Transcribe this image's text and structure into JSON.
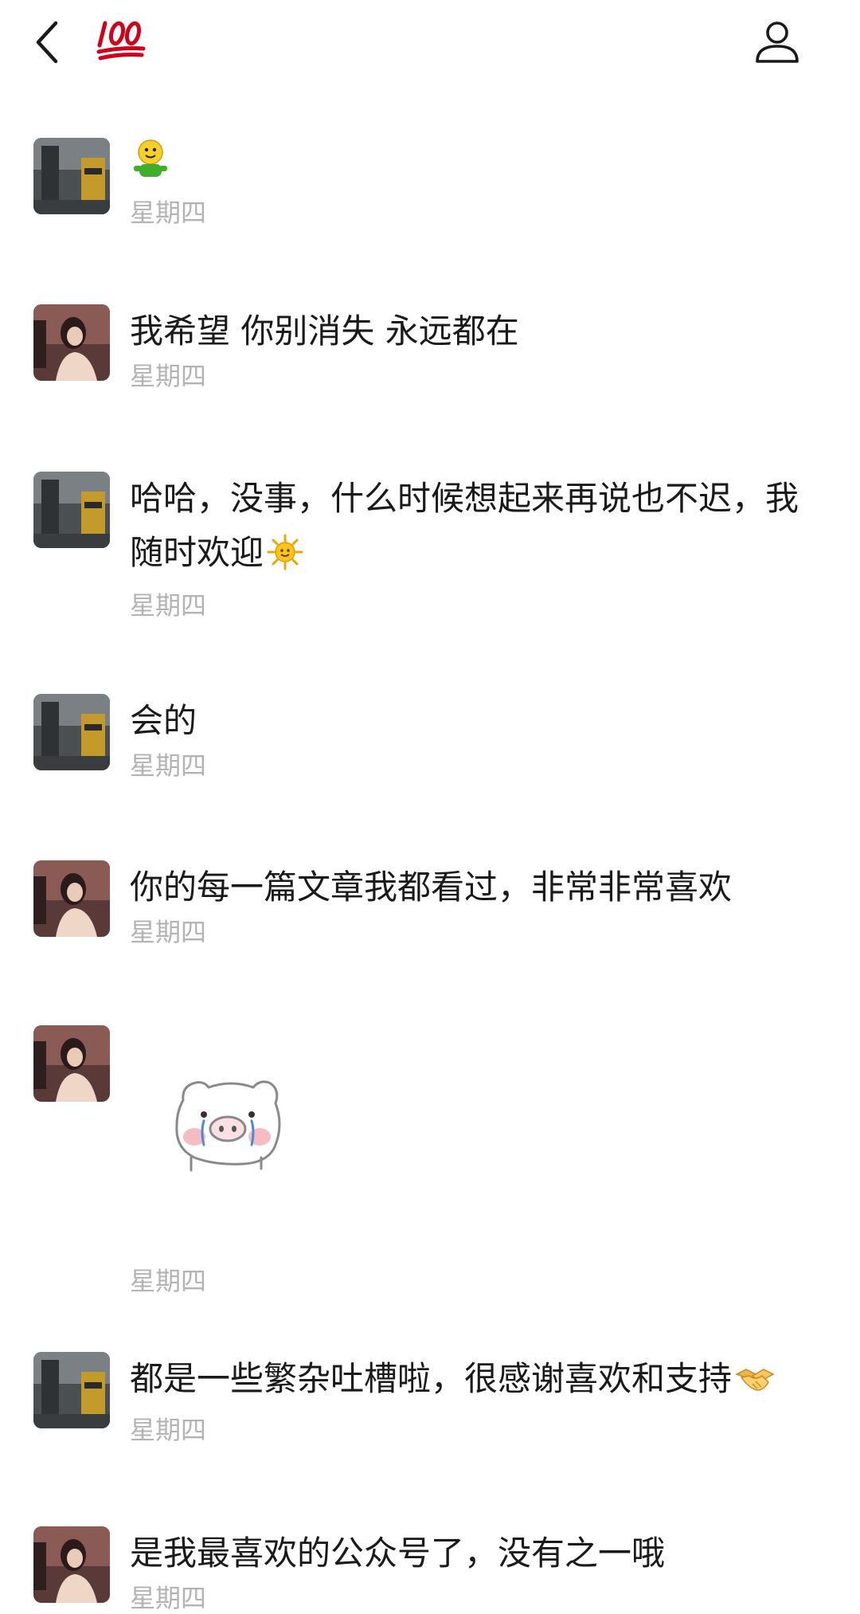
{
  "header": {
    "back_icon": "chevron-left-icon",
    "title_emoji": "💯",
    "profile_icon": "person-outline-icon"
  },
  "messages": [
    {
      "sender": "author",
      "type": "sticker",
      "sticker": "green-smiley-figure",
      "time": "星期四"
    },
    {
      "sender": "reader",
      "type": "text",
      "text": "我希望 你别消失 永远都在",
      "time": "星期四"
    },
    {
      "sender": "author",
      "type": "text",
      "text": "哈哈，没事，什么时候想起来再说也不迟，我随时欢迎",
      "emoji": "sun-icon",
      "time": "星期四"
    },
    {
      "sender": "author",
      "type": "text",
      "text": "会的",
      "time": "星期四"
    },
    {
      "sender": "reader",
      "type": "text",
      "text": "你的每一篇文章我都看过，非常非常喜欢",
      "time": "星期四"
    },
    {
      "sender": "reader",
      "type": "sticker",
      "sticker": "crying-pig",
      "time": "星期四"
    },
    {
      "sender": "author",
      "type": "text",
      "text": "都是一些繁杂吐槽啦，很感谢喜欢和支持",
      "emoji": "handshake-icon",
      "time": "星期四"
    },
    {
      "sender": "reader",
      "type": "text",
      "text": "是我最喜欢的公众号了，没有之一哦",
      "time": "星期四"
    }
  ],
  "colors": {
    "text": "#1a1a1a",
    "timestamp": "#b3b3b3",
    "title_emoji_red": "#d0021b"
  }
}
